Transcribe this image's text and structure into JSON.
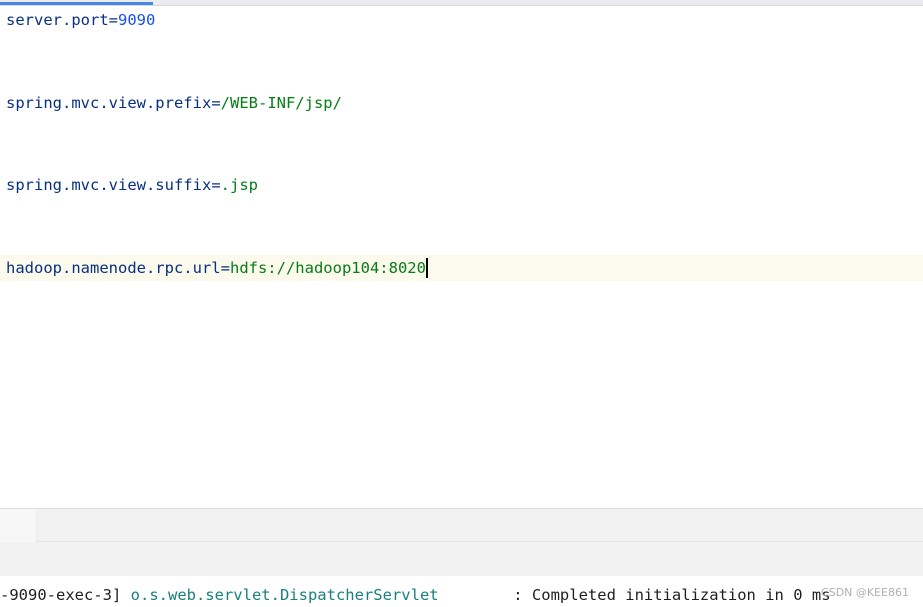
{
  "editor": {
    "lines": [
      {
        "key": "server.port",
        "eq": "=",
        "value": "9090"
      },
      {
        "key": "spring.mvc.view.prefix",
        "eq": "=",
        "value": "/WEB-INF/jsp/"
      },
      {
        "key": "spring.mvc.view.suffix",
        "eq": "=",
        "value": ".jsp"
      },
      {
        "key": "hadoop.namenode.rpc.url",
        "eq": "=",
        "value": "hdfs://hadoop104:8020"
      }
    ]
  },
  "console": {
    "thread": "-9090-exec-3] ",
    "logger": "o.s.web.servlet.DispatcherServlet",
    "message": "        : Completed initialization in 0 ms"
  },
  "watermark": "CSDN @KEE861",
  "colors": {
    "key": "#083080",
    "string_value": "#067d17",
    "number_value": "#1750eb",
    "current_line": "#fcfaed",
    "logger": "#178080",
    "tab_indicator": "#4a86e8"
  }
}
